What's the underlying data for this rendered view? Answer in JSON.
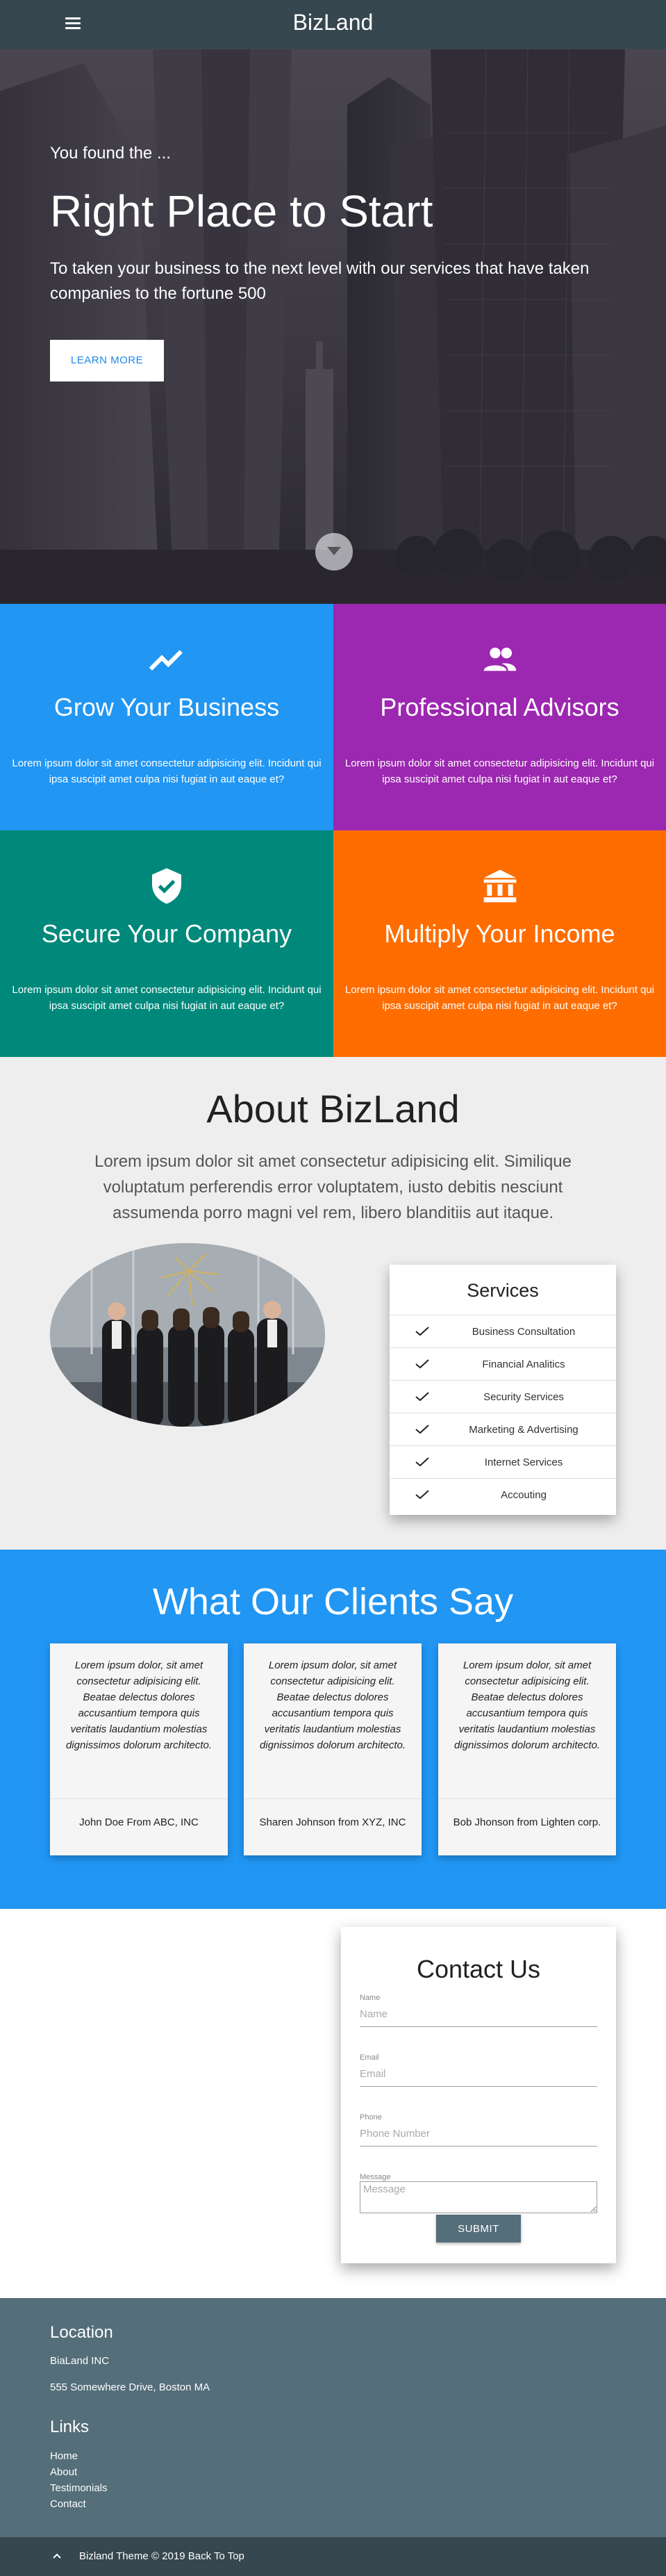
{
  "nav": {
    "brand": "BizLand"
  },
  "hero": {
    "kicker": "You found the ...",
    "title": "Right Place to Start",
    "subtitle": "To taken your business to the next level with our services that have taken companies to the fortune 500",
    "button": "LEARN MORE"
  },
  "features": [
    {
      "icon": "trending-up-icon",
      "title": "Grow Your Business",
      "text": "Lorem ipsum dolor sit amet consectetur adipisicing elit. Incidunt qui ipsa suscipit amet culpa nisi fugiat in aut eaque et?",
      "color": "#2196f3"
    },
    {
      "icon": "people-icon",
      "title": "Professional Advisors",
      "text": "Lorem ipsum dolor sit amet consectetur adipisicing elit. Incidunt qui ipsa suscipit amet culpa nisi fugiat in aut eaque et?",
      "color": "#9c27b0"
    },
    {
      "icon": "shield-check-icon",
      "title": "Secure Your Company",
      "text": "Lorem ipsum dolor sit amet consectetur adipisicing elit. Incidunt qui ipsa suscipit amet culpa nisi fugiat in aut eaque et?",
      "color": "#00897b"
    },
    {
      "icon": "bank-icon",
      "title": "Multiply Your Income",
      "text": "Lorem ipsum dolor sit amet consectetur adipisicing elit. Incidunt qui ipsa suscipit amet culpa nisi fugiat in aut eaque et?",
      "color": "#ff6d00"
    }
  ],
  "about": {
    "title": "About BizLand",
    "text": "Lorem ipsum dolor sit amet consectetur adipisicing elit. Similique voluptatum perferendis error voluptatem, iusto debitis nesciunt assumenda porro magni vel rem, libero blanditiis aut itaque.",
    "services_title": "Services",
    "services": [
      "Business Consultation",
      "Financial Analitics",
      "Security Services",
      "Marketing & Advertising",
      "Internet Services",
      "Accouting"
    ]
  },
  "testimonials": {
    "title": "What Our Clients Say",
    "items": [
      {
        "quote": "Lorem ipsum dolor, sit amet consectetur adipisicing elit. Beatae delectus dolores accusantium tempora quis veritatis laudantium molestias dignissimos dolorum architecto.",
        "author": "John Doe From ABC, INC"
      },
      {
        "quote": "Lorem ipsum dolor, sit amet consectetur adipisicing elit. Beatae delectus dolores accusantium tempora quis veritatis laudantium molestias dignissimos dolorum architecto.",
        "author": "Sharen Johnson from XYZ, INC"
      },
      {
        "quote": "Lorem ipsum dolor, sit amet consectetur adipisicing elit. Beatae delectus dolores accusantium tempora quis veritatis laudantium molestias dignissimos dolorum architecto.",
        "author": "Bob Jhonson from Lighten corp."
      }
    ]
  },
  "contact": {
    "title": "Contact Us",
    "name_label": "Name",
    "name_placeholder": "Name",
    "email_label": "Email",
    "email_placeholder": "Email",
    "phone_label": "Phone",
    "phone_placeholder": "Phone Number",
    "message_label": "Message",
    "message_placeholder": "Message",
    "submit": "SUBMIT"
  },
  "footer": {
    "location_title": "Location",
    "company": "BiaLand INC",
    "address": "555 Somewhere Drive, Boston MA",
    "links_title": "Links",
    "links": [
      "Home",
      "About",
      "Testimonials",
      "Contact"
    ],
    "copyright": "Bizland Theme © 2019",
    "back_to_top": "Back To Top"
  }
}
